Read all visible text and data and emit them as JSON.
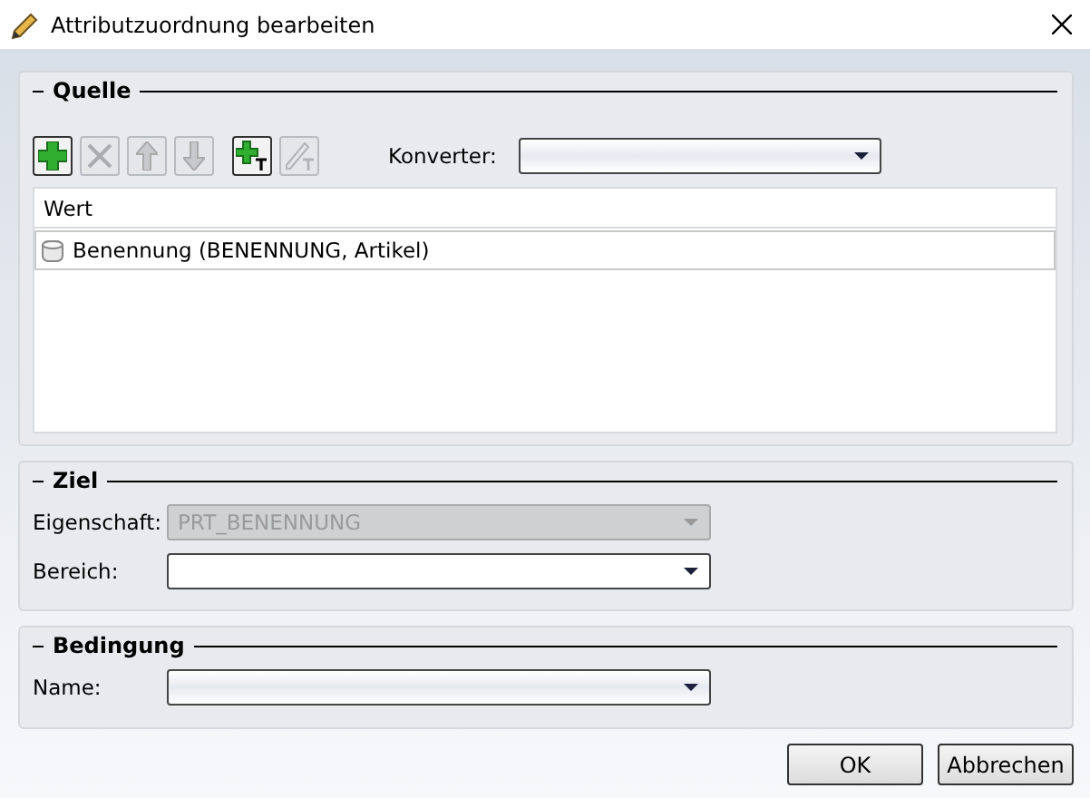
{
  "window": {
    "title": "Attributzuordnung bearbeiten"
  },
  "source": {
    "title": "Quelle",
    "tools": [
      {
        "kind": "add",
        "disabled": false
      },
      {
        "kind": "delete",
        "disabled": true
      },
      {
        "kind": "up",
        "disabled": true
      },
      {
        "kind": "down",
        "disabled": true
      },
      {
        "kind": "addtext",
        "disabled": false
      },
      {
        "kind": "edittext",
        "disabled": true
      }
    ],
    "converter": {
      "label": "Konverter:"
    },
    "list": {
      "column": "Wert",
      "rows": [
        {
          "text": "Benennung (BENENNUNG, Artikel)",
          "selected": true
        }
      ]
    }
  },
  "target": {
    "title": "Ziel",
    "fields": [
      {
        "label": "Eigenschaft:",
        "value": "PRT_BENENNUNG",
        "disabled": true
      },
      {
        "label": "Bereich:",
        "disabled": false
      }
    ]
  },
  "condition": {
    "title": "Bedingung",
    "fields": [
      {
        "label": "Name:",
        "disabled": false
      }
    ]
  },
  "buttons": [
    "OK",
    "Abbrechen"
  ]
}
